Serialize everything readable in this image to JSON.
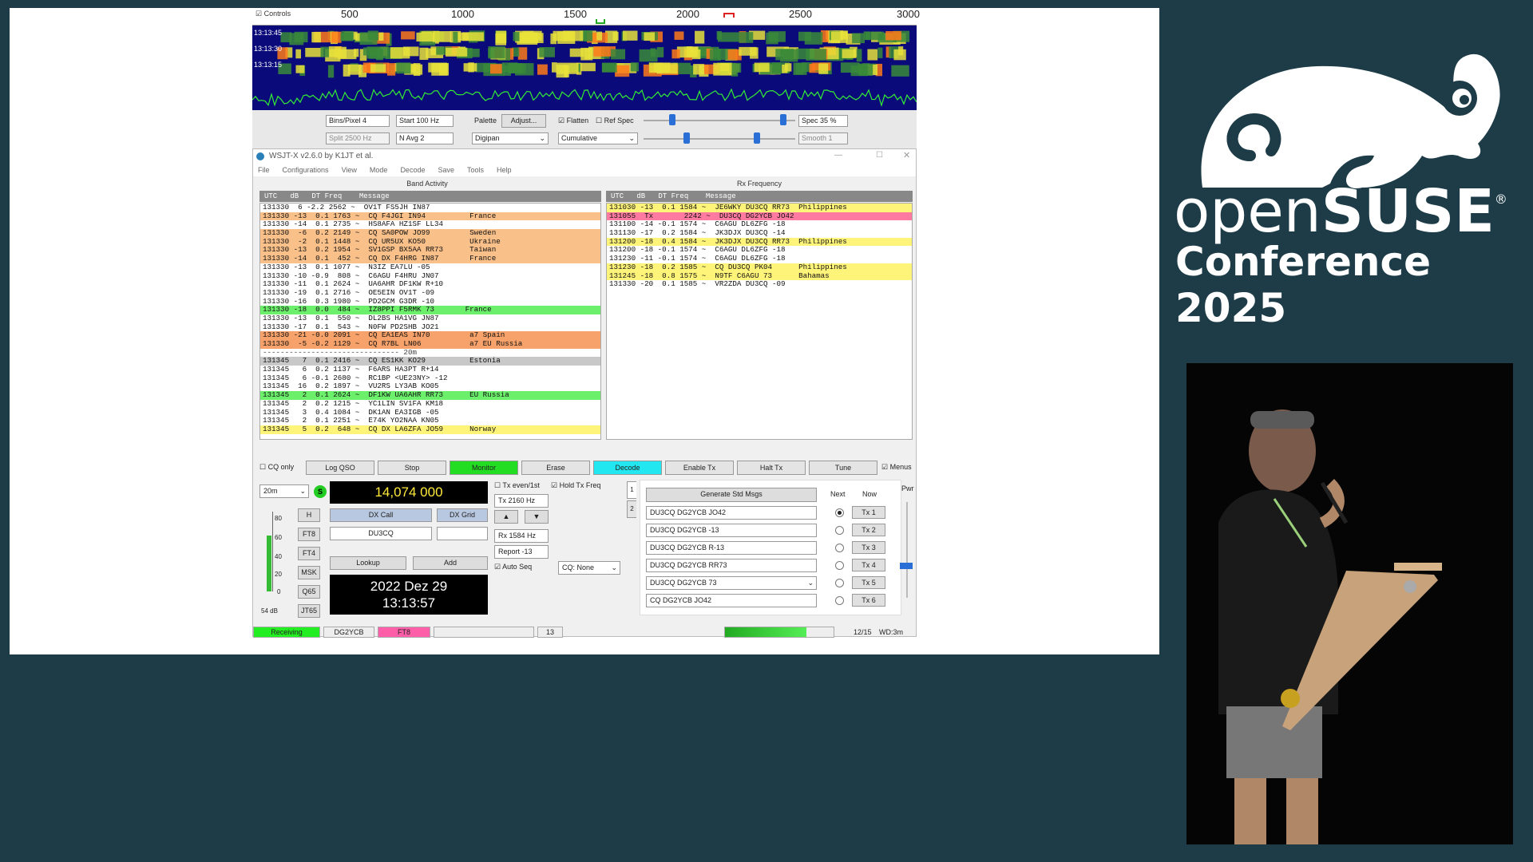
{
  "waterfall": {
    "controls_label": "Controls",
    "ruler_ticks": [
      "500",
      "1000",
      "1500",
      "2000",
      "2500",
      "3000"
    ],
    "row_times": [
      "13:13:45",
      "13:13:30",
      "13:13:15"
    ],
    "bins_per_pixel": "Bins/Pixel  4",
    "start": "Start  100 Hz",
    "palette_label": "Palette",
    "adjust_label": "Adjust...",
    "flatten_label": "Flatten",
    "ref_spec_label": "Ref Spec",
    "spec": "Spec  35 %",
    "split": "Split  2500 Hz",
    "n_avg": "N Avg  2",
    "palette_value": "Digipan",
    "cumulative": "Cumulative",
    "smooth": "Smooth  1"
  },
  "window": {
    "title": "WSJT-X   v2.6.0   by K1JT et al.",
    "menu": [
      "File",
      "Configurations",
      "View",
      "Mode",
      "Decode",
      "Save",
      "Tools",
      "Help"
    ]
  },
  "band_activity": {
    "title": "Band Activity",
    "header": "UTC   dB   DT Freq    Message",
    "rows": [
      {
        "text": "131330  6 -2.2 2562 ~  OV1T FS5JH IN87",
        "style": ""
      },
      {
        "text": "131330 -13  0.1 1763 ~  CQ F4JGI IN94          France",
        "style": "orange"
      },
      {
        "text": "131330 -14  0.1 2735 ~  HS8AFA HZ1SF LL34",
        "style": ""
      },
      {
        "text": "131330  -6  0.2 2149 ~  CQ SA0POW JO99         Sweden",
        "style": "orange"
      },
      {
        "text": "131330  -2  0.1 1448 ~  CQ UR5UX KO50          Ukraine",
        "style": "orange"
      },
      {
        "text": "131330 -13  0.2 1954 ~  SV1GSP BX5AA RR73      Taiwan",
        "style": "orange"
      },
      {
        "text": "131330 -14  0.1  452 ~  CQ DX F4HRG IN87       France",
        "style": "orange"
      },
      {
        "text": "131330 -13  0.1 1077 ~  N3IZ EA7LU -05",
        "style": ""
      },
      {
        "text": "131330 -10 -0.9  808 ~  C6AGU F4HRU JN07",
        "style": ""
      },
      {
        "text": "131330 -11  0.1 2624 ~  UA6AHR DF1KW R+10",
        "style": ""
      },
      {
        "text": "131330 -19  0.1 2716 ~  OE5EIN OV1T -09",
        "style": ""
      },
      {
        "text": "131330 -16  0.3 1980 ~  PD2GCM G3DR -10",
        "style": ""
      },
      {
        "text": "131330 -18  0.0  484 ~  IZ8PPI F5RMK 73       France",
        "style": "green"
      },
      {
        "text": "131330 -13  0.1  550 ~  DL2BS HA1VG JN87",
        "style": ""
      },
      {
        "text": "131330 -17  0.1  543 ~  N0FW PD2SHB JO21",
        "style": ""
      },
      {
        "text": "131330 -21 -0.0 2091 ~  CQ EA1EAS IN70         a7 Spain",
        "style": "dorange"
      },
      {
        "text": "131330  -5 -0.2 1129 ~  CQ R7BL LN06           a7 EU Russia",
        "style": "dorange"
      },
      {
        "text": "------------------------------- 20m",
        "style": "sep"
      },
      {
        "text": "131345   7  0.1 2416 ~  CQ ES1KK KO29          Estonia",
        "style": "gray"
      },
      {
        "text": "131345   6  0.2 1137 ~  F6ARS HA3PT R+14",
        "style": ""
      },
      {
        "text": "131345   6 -0.1 2680 ~  RC1BP <UE23NY> -12",
        "style": ""
      },
      {
        "text": "131345  16  0.2 1897 ~  VU2RS LY3AB KO05",
        "style": ""
      },
      {
        "text": "131345   2  0.1 2624 ~  DF1KW UA6AHR RR73      EU Russia",
        "style": "green"
      },
      {
        "text": "131345   2  0.2 1215 ~  YC1LIN SV1FA KM18",
        "style": ""
      },
      {
        "text": "131345   3  0.4 1084 ~  DK1AN EA3IGB -05",
        "style": ""
      },
      {
        "text": "131345   2  0.1 2251 ~  E74K YO2NAA KN05",
        "style": ""
      },
      {
        "text": "131345   5  0.2  648 ~  CQ DX LA6ZFA JO59      Norway",
        "style": "yellow"
      }
    ]
  },
  "rx_frequency": {
    "title": "Rx Frequency",
    "header": "UTC   dB   DT Freq    Message",
    "rows": [
      {
        "text": "131030 -13  0.1 1584 ~  JE6WKY DU3CQ RR73  Philippines",
        "style": "yellow"
      },
      {
        "text": "131055  Tx       2242 ~  DU3CQ DG2YCB JO42",
        "style": "pink"
      },
      {
        "text": "131100 -14 -0.1 1574 ~  C6AGU DL6ZFG -18",
        "style": ""
      },
      {
        "text": "131130 -17  0.2 1584 ~  JK3DJX DU3CQ -14",
        "style": ""
      },
      {
        "text": "131200 -18  0.4 1584 ~  JK3DJX DU3CQ RR73  Philippines",
        "style": "yellow"
      },
      {
        "text": "131200 -18 -0.1 1574 ~  C6AGU DL6ZFG -18",
        "style": ""
      },
      {
        "text": "131230 -11 -0.1 1574 ~  C6AGU DL6ZFG -18",
        "style": ""
      },
      {
        "text": "131230 -18  0.2 1585 ~  CQ DU3CQ PK04      Philippines",
        "style": "yellow"
      },
      {
        "text": "131245 -18  0.8 1575 ~  N9TF C6AGU 73      Bahamas",
        "style": "yellow"
      },
      {
        "text": "131330 -20  0.1 1585 ~  VR2ZDA DU3CQ -09",
        "style": ""
      }
    ]
  },
  "buttons": {
    "cq_only": "CQ only",
    "log_qso": "Log QSO",
    "stop": "Stop",
    "monitor": "Monitor",
    "erase": "Erase",
    "decode": "Decode",
    "enable_tx": "Enable Tx",
    "halt_tx": "Halt Tx",
    "tune": "Tune",
    "menus": "Menus"
  },
  "controls": {
    "band": "20m",
    "dial_freq": "14,074 000",
    "s_label": "S",
    "meter_ticks": [
      "80",
      "60",
      "40",
      "20",
      "0"
    ],
    "meter_db": "54 dB",
    "mode_buttons": [
      "H",
      "FT8",
      "FT4",
      "MSK",
      "Q65",
      "JT65"
    ],
    "dx_call_label": "DX Call",
    "dx_grid_label": "DX Grid",
    "dx_call_value": "DU3CQ",
    "dx_grid_value": "",
    "lookup": "Lookup",
    "add": "Add",
    "date": "2022 Dez 29",
    "time": "13:13:57",
    "tx_even": "Tx even/1st",
    "hold_tx_freq": "Hold Tx Freq",
    "tx_hz": "Tx  2160 Hz",
    "rx_hz": "Rx  1584 Hz",
    "report": "Report -13",
    "auto_seq": "Auto Seq",
    "cq_none": "CQ: None",
    "up_arrow": "▲",
    "down_arrow": "▼"
  },
  "messages": {
    "generate": "Generate Std Msgs",
    "next_label": "Next",
    "now_label": "Now",
    "pwr_label": "Pwr",
    "items": [
      {
        "msg": "DU3CQ DG2YCB JO42",
        "tx": "Tx 1"
      },
      {
        "msg": "DU3CQ DG2YCB -13",
        "tx": "Tx 2"
      },
      {
        "msg": "DU3CQ DG2YCB R-13",
        "tx": "Tx 3"
      },
      {
        "msg": "DU3CQ DG2YCB RR73",
        "tx": "Tx 4"
      },
      {
        "msg": "DU3CQ DG2YCB 73",
        "tx": "Tx 5"
      },
      {
        "msg": "CQ DG2YCB JO42",
        "tx": "Tx 6"
      }
    ]
  },
  "status": {
    "receiving": "Receiving",
    "call": "DG2YCB",
    "mode": "FT8",
    "count": "13",
    "progress": 0.75,
    "period": "12/15",
    "wd": "WD:3m"
  },
  "conference": {
    "brand_light": "open",
    "brand_bold": "SUSE",
    "registered": "®",
    "title": "Conference 2025"
  },
  "colors": {
    "background": "#1d3c47",
    "monitor_green": "#22dd22",
    "decode_cyan": "#22e6f0",
    "freq_yellow": "#ffea3a"
  }
}
